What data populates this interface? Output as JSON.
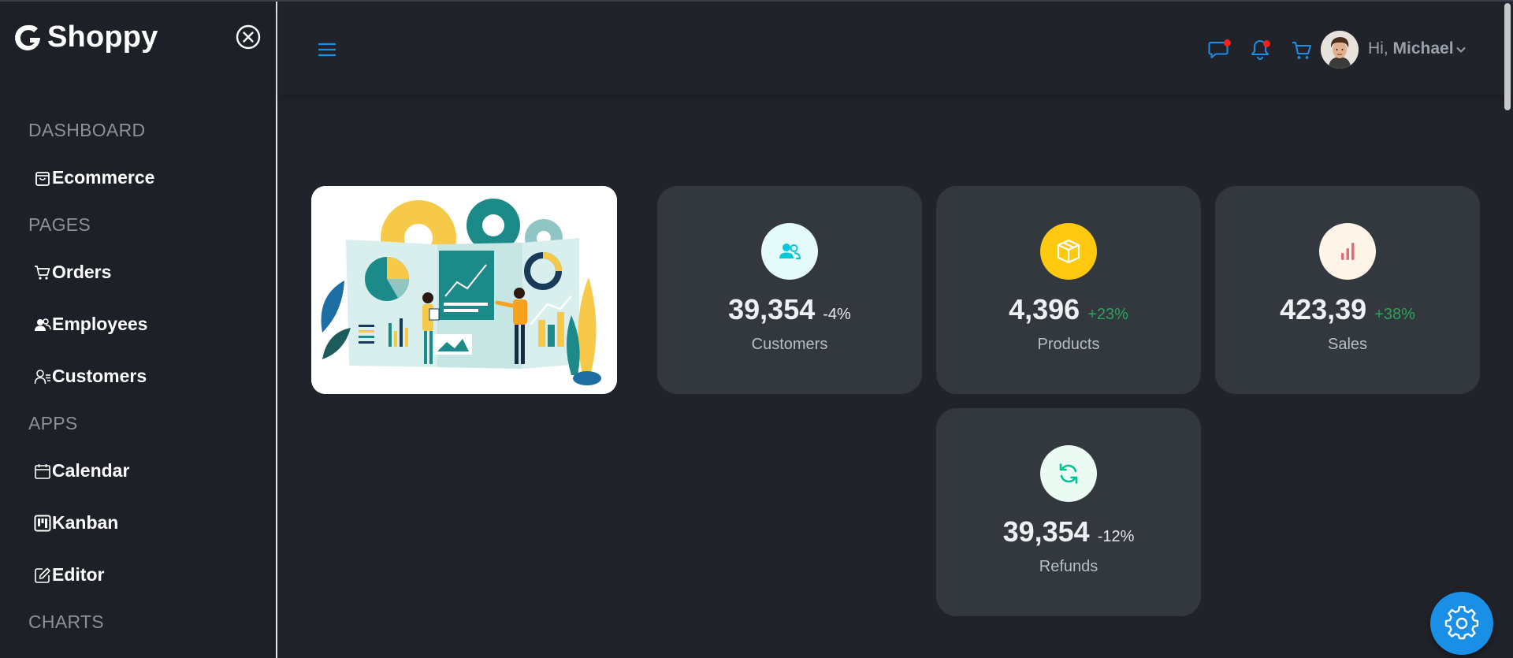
{
  "app": {
    "brand": "Shoppy"
  },
  "sidebar": {
    "sections": [
      {
        "title": "DASHBOARD",
        "items": [
          {
            "label": "Ecommerce",
            "icon": "shopping-bag-icon"
          }
        ]
      },
      {
        "title": "PAGES",
        "items": [
          {
            "label": "Orders",
            "icon": "cart-icon"
          },
          {
            "label": "Employees",
            "icon": "employees-icon"
          },
          {
            "label": "Customers",
            "icon": "customers-icon"
          }
        ]
      },
      {
        "title": "APPS",
        "items": [
          {
            "label": "Calendar",
            "icon": "calendar-icon"
          },
          {
            "label": "Kanban",
            "icon": "kanban-icon"
          },
          {
            "label": "Editor",
            "icon": "editor-icon"
          }
        ]
      },
      {
        "title": "CHARTS",
        "items": []
      }
    ]
  },
  "header": {
    "greeting": "Hi,",
    "user_name": "Michael",
    "icons": [
      "chat-icon",
      "bell-icon",
      "cart-icon"
    ],
    "accent": "#1a8fe6",
    "notification_color": "#ff1e1e"
  },
  "stats": [
    {
      "value": "39,354",
      "change": "-4%",
      "label": "Customers",
      "icon": "customers-icon",
      "icon_bg": "#e5fafb",
      "icon_color": "#03c9d7",
      "change_color": "#e6e8eb"
    },
    {
      "value": "4,396",
      "change": "+23%",
      "label": "Products",
      "icon": "box-icon",
      "icon_bg": "#fec90f",
      "icon_color": "#ffffff",
      "change_color": "#2aa35b"
    },
    {
      "value": "423,39",
      "change": "+38%",
      "label": "Sales",
      "icon": "bar-chart-icon",
      "icon_bg": "#fff4e8",
      "icon_color": "#e46a76",
      "change_color": "#2aa35b"
    },
    {
      "value": "39,354",
      "change": "-12%",
      "label": "Refunds",
      "icon": "refresh-icon",
      "icon_bg": "#ebfaf2",
      "icon_color": "#00c292",
      "change_color": "#e6e8eb"
    }
  ]
}
